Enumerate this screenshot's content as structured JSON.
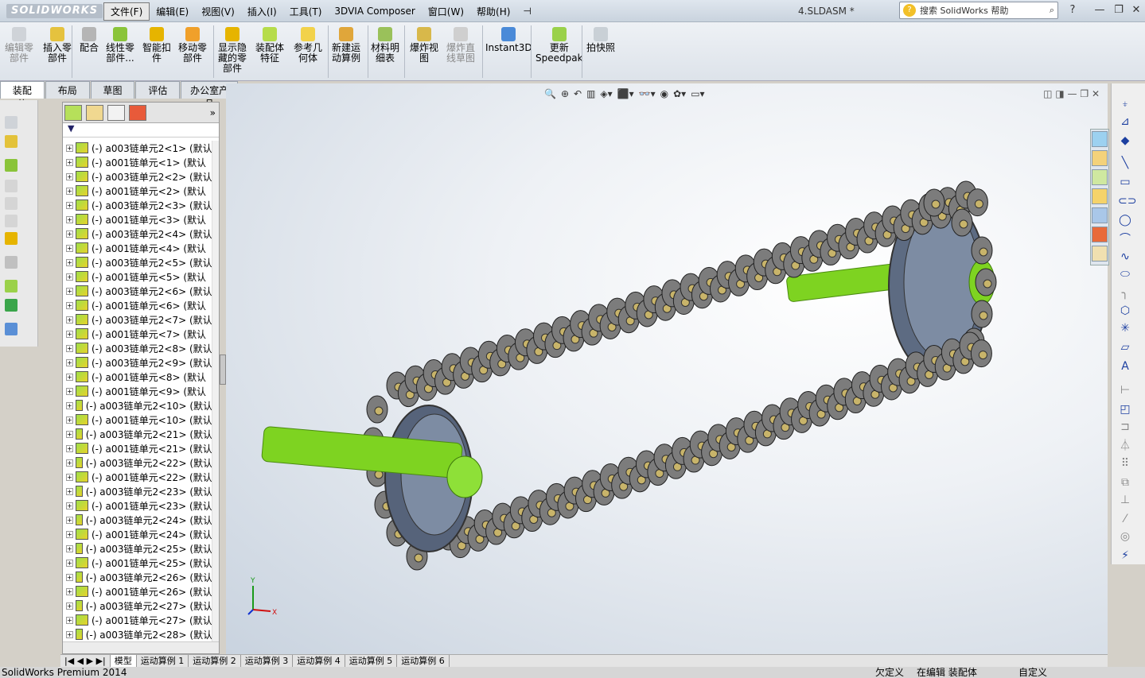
{
  "titlebar": {
    "logo": "SOLIDWORKS",
    "doc_title": "4.SLDASM *",
    "help_search_placeholder": "搜索 SolidWorks 帮助",
    "help_icon": "?"
  },
  "menu": [
    "文件(F)",
    "编辑(E)",
    "视图(V)",
    "插入(I)",
    "工具(T)",
    "3DVIA Composer",
    "窗口(W)",
    "帮助(H)"
  ],
  "commands": [
    {
      "l1": "编辑零",
      "l2": "部件",
      "l3": "",
      "disabled": true
    },
    {
      "l1": "插入零",
      "l2": "部件",
      "l3": "",
      "disabled": false
    },
    {
      "l1": "配合",
      "l2": "",
      "l3": "",
      "disabled": false
    },
    {
      "l1": "线性零",
      "l2": "部件...",
      "l3": "",
      "disabled": false
    },
    {
      "l1": "智能扣",
      "l2": "件",
      "l3": "",
      "disabled": false
    },
    {
      "l1": "移动零",
      "l2": "部件",
      "l3": "",
      "disabled": false
    },
    {
      "l1": "显示隐",
      "l2": "藏的零",
      "l3": "部件",
      "disabled": false
    },
    {
      "l1": "装配体",
      "l2": "特征",
      "l3": "",
      "disabled": false
    },
    {
      "l1": "参考几",
      "l2": "何体",
      "l3": "",
      "disabled": false
    },
    {
      "l1": "新建运",
      "l2": "动算例",
      "l3": "",
      "disabled": false
    },
    {
      "l1": "材料明",
      "l2": "细表",
      "l3": "",
      "disabled": false
    },
    {
      "l1": "爆炸视",
      "l2": "图",
      "l3": "",
      "disabled": false
    },
    {
      "l1": "爆炸直",
      "l2": "线草图",
      "l3": "",
      "disabled": true
    },
    {
      "l1": "Instant3D",
      "l2": "",
      "l3": "",
      "disabled": false
    },
    {
      "l1": "更新",
      "l2": "Speedpak",
      "l3": "",
      "disabled": false
    },
    {
      "l1": "拍快照",
      "l2": "",
      "l3": "",
      "disabled": false
    }
  ],
  "tabs": [
    "装配体",
    "布局",
    "草图",
    "评估",
    "办公室产品"
  ],
  "tree": [
    "(-) a003链单元2<1> (默认",
    "(-) a001链单元<1> (默认",
    "(-) a003链单元2<2> (默认",
    "(-) a001链单元<2> (默认",
    "(-) a003链单元2<3> (默认",
    "(-) a001链单元<3> (默认",
    "(-) a003链单元2<4> (默认",
    "(-) a001链单元<4> (默认",
    "(-) a003链单元2<5> (默认",
    "(-) a001链单元<5> (默认",
    "(-) a003链单元2<6> (默认",
    "(-) a001链单元<6> (默认",
    "(-) a003链单元2<7> (默认",
    "(-) a001链单元<7> (默认",
    "(-) a003链单元2<8> (默认",
    "(-) a003链单元2<9> (默认",
    "(-) a001链单元<8> (默认",
    "(-) a001链单元<9> (默认",
    "(-) a003链单元2<10> (默认",
    "(-) a001链单元<10> (默认",
    "(-) a003链单元2<21> (默认",
    "(-) a001链单元<21> (默认",
    "(-) a003链单元2<22> (默认",
    "(-) a001链单元<22> (默认",
    "(-) a003链单元2<23> (默认",
    "(-) a001链单元<23> (默认",
    "(-) a003链单元2<24> (默认",
    "(-) a001链单元<24> (默认",
    "(-) a003链单元2<25> (默认",
    "(-) a001链单元<25> (默认",
    "(-) a003链单元2<26> (默认",
    "(-) a001链单元<26> (默认",
    "(-) a003链单元2<27> (默认",
    "(-) a001链单元<27> (默认",
    "(-) a003链单元2<28> (默认"
  ],
  "motion_tabs": [
    "模型",
    "运动算例 1",
    "运动算例 2",
    "运动算例 3",
    "运动算例 4",
    "运动算例 5",
    "运动算例 6"
  ],
  "status": {
    "product": "SolidWorks Premium 2014",
    "undefined": "欠定义",
    "editing": "在编辑 装配体",
    "custom": "自定义"
  },
  "colors": {
    "shaft": "#7ed321",
    "sprocket": "#6b7b92",
    "link": "#7c7c7c",
    "pin": "#c8b46a"
  }
}
